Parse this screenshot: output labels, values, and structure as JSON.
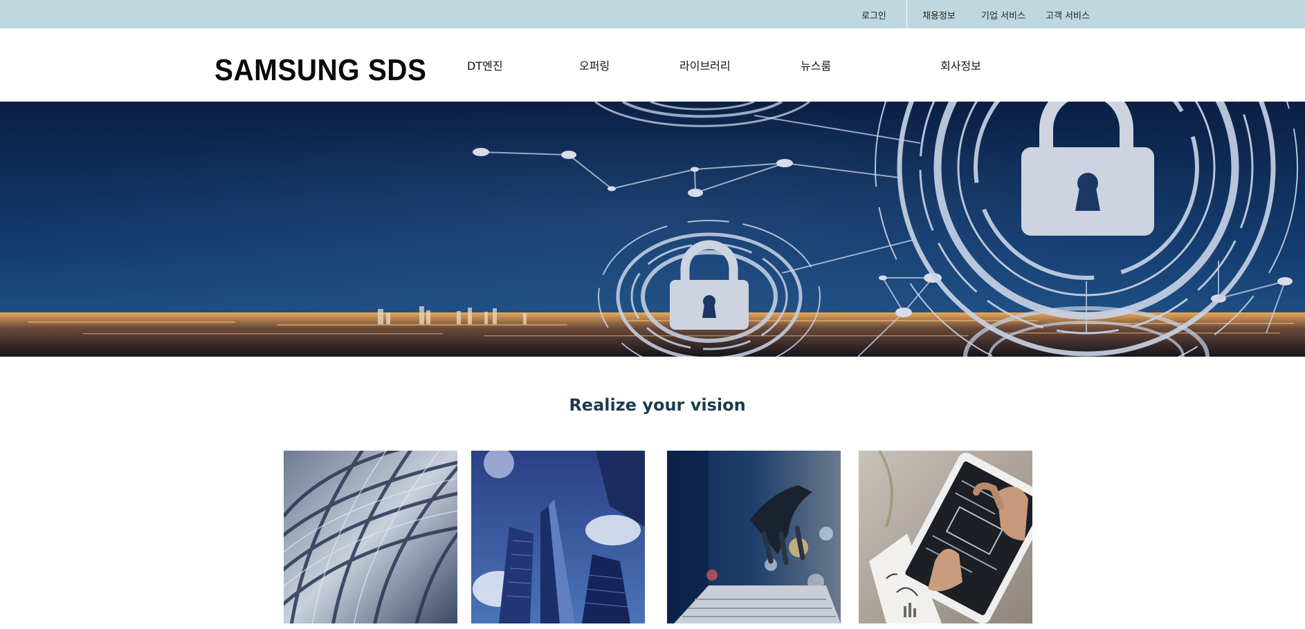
{
  "utility": {
    "login": "로그인",
    "careers": "채용정보",
    "enterprise": "기업 서비스",
    "customer": "고객 서비스"
  },
  "brand": {
    "logo": "SAMSUNG SDS"
  },
  "nav": {
    "items": [
      {
        "label": "DT엔진"
      },
      {
        "label": "오퍼링"
      },
      {
        "label": "라이브러리"
      },
      {
        "label": "뉴스룸"
      },
      {
        "label": "회사정보"
      }
    ]
  },
  "section": {
    "title": "Realize your vision"
  },
  "colors": {
    "utility_bar": "#bfd7de",
    "hero_dark": "#0c2449",
    "title": "#1e3a4c"
  },
  "icons": {
    "hero": [
      "padlock-icon",
      "padlock-icon"
    ],
    "cards": [
      "glass-dome-image",
      "skyscraper-image",
      "robot-hand-laptop-image",
      "tablet-hands-image"
    ]
  }
}
